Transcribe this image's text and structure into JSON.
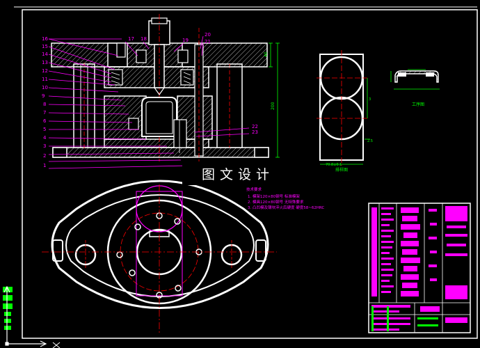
{
  "watermark": "图文设计",
  "part_numbers": [
    "1",
    "2",
    "3",
    "4",
    "5",
    "6",
    "7",
    "8",
    "9",
    "10",
    "11",
    "12",
    "13",
    "14",
    "15",
    "16",
    "17",
    "18",
    "19",
    "20",
    "21",
    "22",
    "23"
  ],
  "side_view_label": "排样图",
  "section_label": "工序图",
  "tech_requirements": {
    "title": "技术要求",
    "items": [
      "1. 模架120×80钢号 标准模架",
      "2. 模具120×80钢号 无特殊要求",
      "3. 凸凹模及镶块淬火后硬度 硬度58~62HRC"
    ]
  },
  "dims": {
    "height_left": "40",
    "height_total": "200",
    "strip_width": "72",
    "strip_pitch": "3",
    "strip_bottom": "2.5",
    "strip_top": "70.8±0.1"
  },
  "colors": {
    "background": "#000000",
    "outline": "#ffffff",
    "leader": "#ff00ff",
    "dimension": "#00ff00",
    "centerline": "#ff0000",
    "hatch": "#ffffff",
    "title_block_fill": "#ff00ff"
  },
  "icons": {
    "ucs": "ucs-axis-icon"
  }
}
